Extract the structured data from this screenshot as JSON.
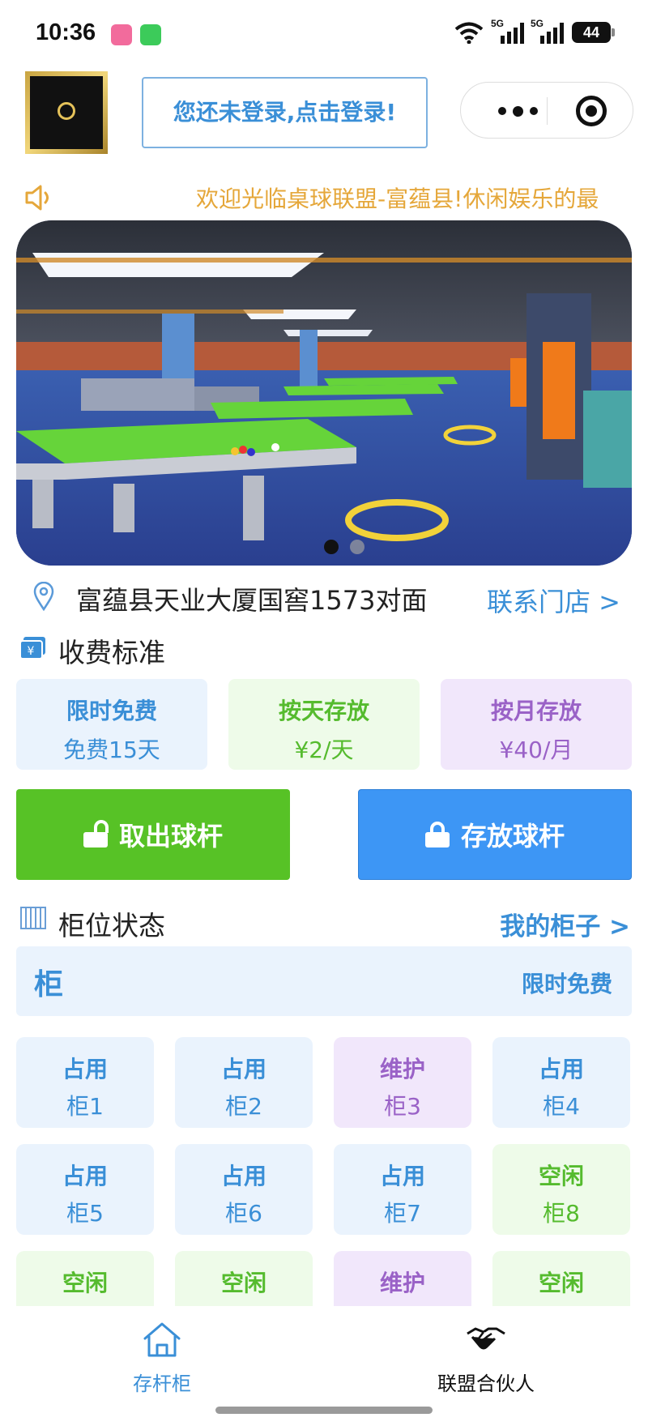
{
  "status_bar": {
    "time": "10:36",
    "signal_1_label": "5G",
    "signal_2_label": "5G",
    "battery": "44",
    "icons": [
      "bilibili-app-icon",
      "message-app-icon",
      "wifi-icon",
      "signal-icon",
      "signal-icon",
      "battery-icon"
    ]
  },
  "header": {
    "login_label": "您还未登录,点击登录!",
    "capsule_icons": [
      "more-icon",
      "close-target-icon"
    ]
  },
  "notice": {
    "icon": "speaker-icon",
    "text": "欢迎光临桌球联盟-富蕴县!休闲娱乐的最"
  },
  "banner": {
    "slide_count": 2,
    "active_slide": 1,
    "image_description": "billiard-hall-photo"
  },
  "store": {
    "address": "富蕴县天业大厦国窖1573对面",
    "contact_label": "联系门店 >"
  },
  "fees": {
    "title": "收费标准",
    "items": [
      {
        "title": "限时免费",
        "value": "免费15天",
        "color": "#3a8fd7"
      },
      {
        "title": "按天存放",
        "value": "¥2/天",
        "color": "#55bb2e"
      },
      {
        "title": "按月存放",
        "value": "¥40/月",
        "color": "#9a62c7"
      }
    ]
  },
  "actions": {
    "take_out_label": "取出球杆",
    "store_label": "存放球杆",
    "take_out_color": "#57c226",
    "store_color": "#3d96f5"
  },
  "cabinets": {
    "title": "柜位状态",
    "my_cabinet_label": "我的柜子 >",
    "group_label": "柜",
    "group_badge": "限时免费",
    "items": [
      {
        "status": "占用",
        "name": "柜1",
        "state": "used"
      },
      {
        "status": "占用",
        "name": "柜2",
        "state": "used"
      },
      {
        "status": "维护",
        "name": "柜3",
        "state": "maint"
      },
      {
        "status": "占用",
        "name": "柜4",
        "state": "used"
      },
      {
        "status": "占用",
        "name": "柜5",
        "state": "used"
      },
      {
        "status": "占用",
        "name": "柜6",
        "state": "used"
      },
      {
        "status": "占用",
        "name": "柜7",
        "state": "used"
      },
      {
        "status": "空闲",
        "name": "柜8",
        "state": "free"
      },
      {
        "status": "空闲",
        "name": "",
        "state": "free"
      },
      {
        "status": "空闲",
        "name": "",
        "state": "free"
      },
      {
        "status": "维护",
        "name": "",
        "state": "maint"
      },
      {
        "status": "空闲",
        "name": "",
        "state": "free"
      }
    ]
  },
  "tabbar": {
    "tabs": [
      {
        "label": "存杆柜",
        "icon": "home-icon",
        "active": true
      },
      {
        "label": "联盟合伙人",
        "icon": "handshake-icon",
        "active": false
      }
    ]
  }
}
